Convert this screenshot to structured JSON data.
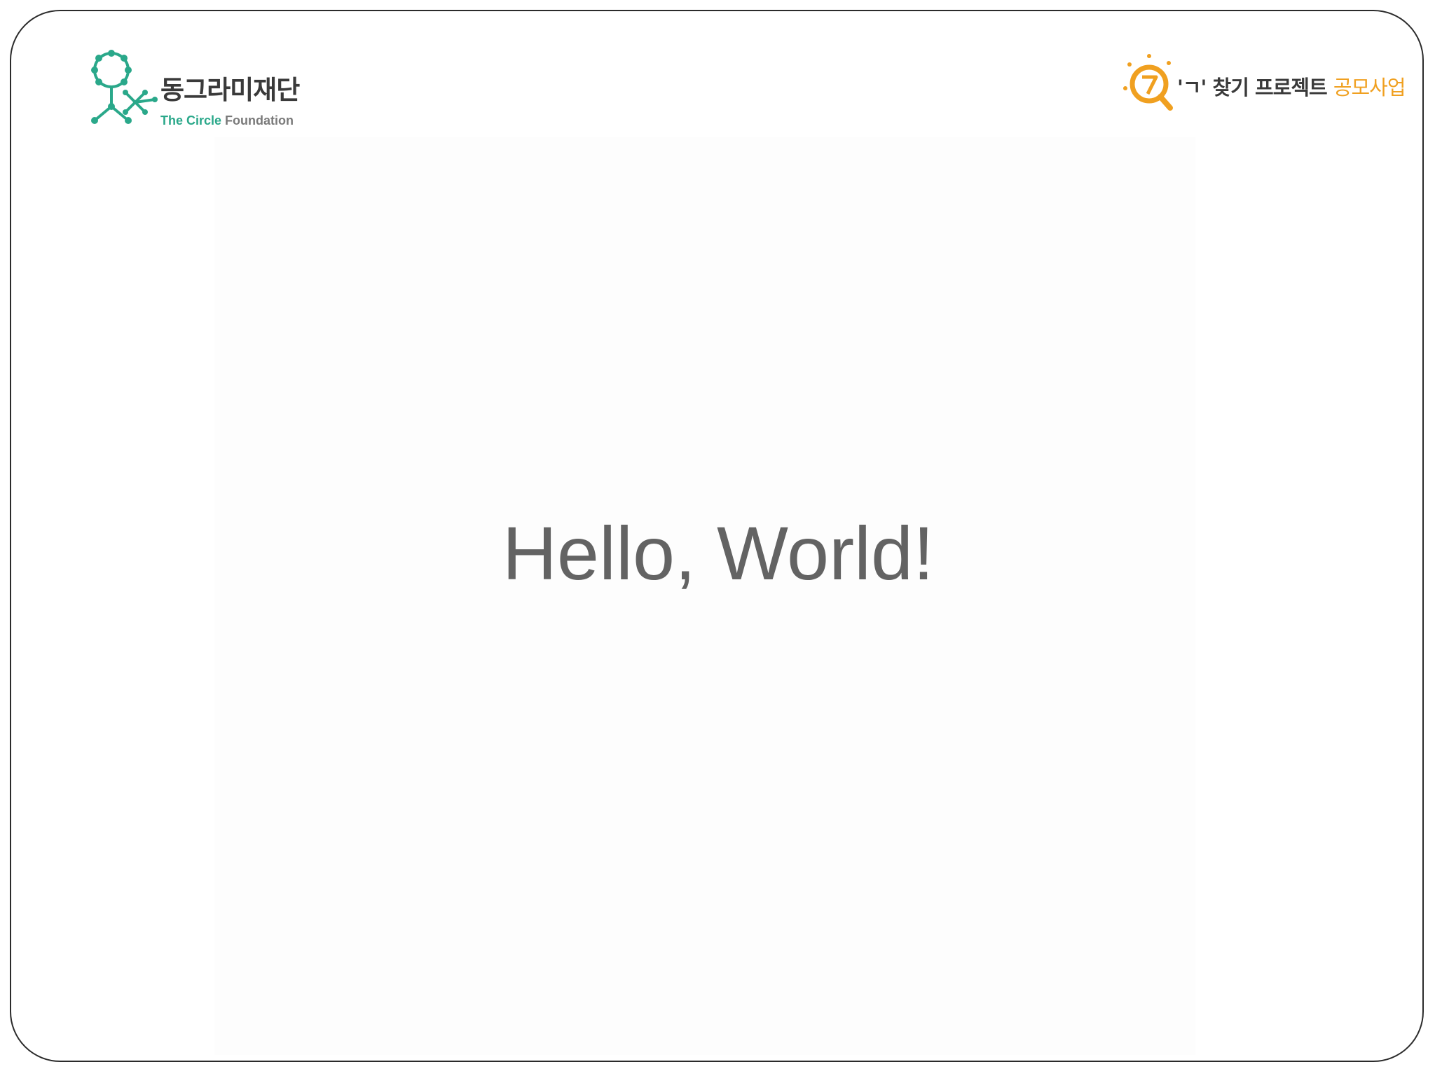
{
  "slide": {
    "headline": "Hello, World!"
  },
  "logo_left": {
    "korean_name": "동그라미재단",
    "english_accent": "The Circle",
    "english_rest": " Foundation",
    "icon": "circle-figure-logo-icon",
    "brand_color": "#2aa88a"
  },
  "logo_right": {
    "project_name": "'ㄱ' 찾기 프로젝트 ",
    "project_suffix": "공모사업",
    "icon": "magnifier-seven-logo-icon",
    "brand_color": "#f0a020"
  }
}
